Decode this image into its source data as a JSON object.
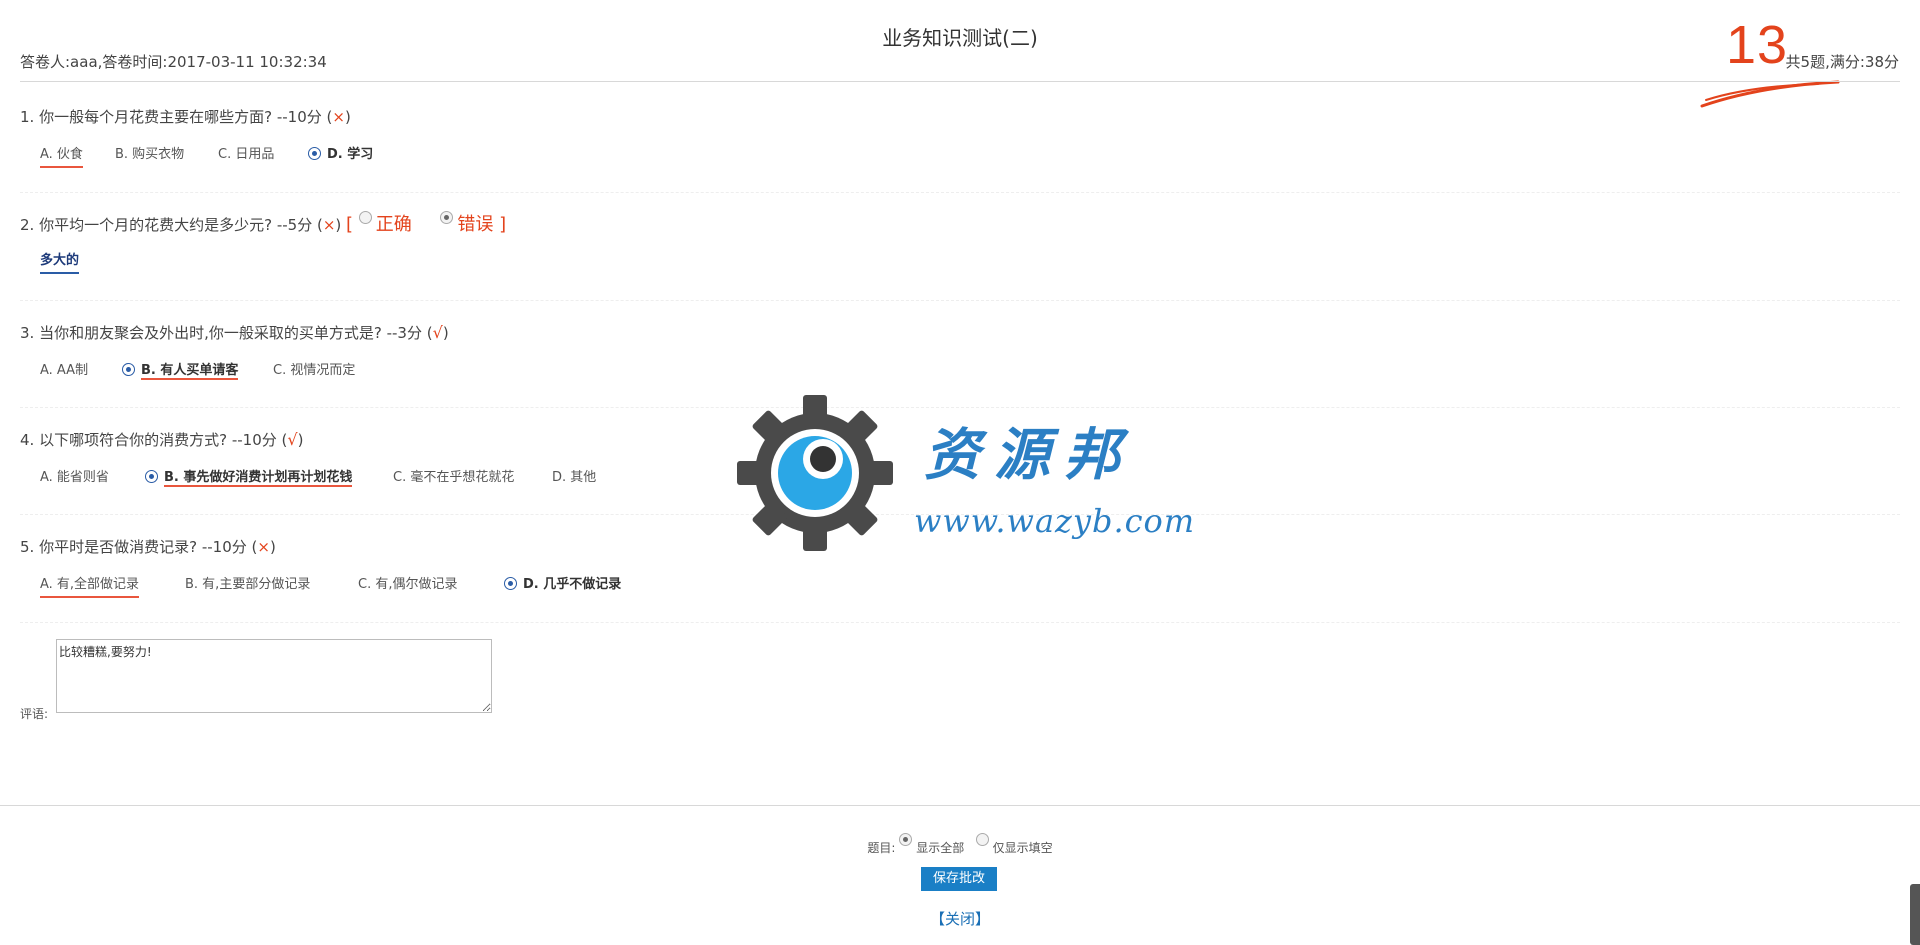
{
  "header": {
    "title": "业务知识测试(二)",
    "meta": "答卷人:aaa,答卷时间:2017-03-11 10:32:34",
    "score": "13",
    "summary": "共5题,满分:38分"
  },
  "questions": [
    {
      "num": "1.",
      "text": "你一般每个月花费主要在哪些方面?",
      "points": "--10分",
      "result": "×",
      "options": [
        {
          "label": "A. 伙食",
          "selected": false
        },
        {
          "label": "B. 购买衣物",
          "selected": false
        },
        {
          "label": "C. 日用品",
          "selected": false
        },
        {
          "label": "D. 学习",
          "selected": true
        }
      ]
    },
    {
      "num": "2.",
      "text": "你平均一个月的花费大约是多少元?",
      "points": "--5分",
      "result": "×",
      "judge_correct": "正确",
      "judge_wrong": "错误",
      "answer": "多大的"
    },
    {
      "num": "3.",
      "text": "当你和朋友聚会及外出时,你一般采取的买单方式是?",
      "points": "--3分",
      "result": "√",
      "options": [
        {
          "label": "A. AA制",
          "selected": false
        },
        {
          "label": "B. 有人买单请客",
          "selected": true
        },
        {
          "label": "C. 视情况而定",
          "selected": false
        }
      ]
    },
    {
      "num": "4.",
      "text": "以下哪项符合你的消费方式?",
      "points": "--10分",
      "result": "√",
      "options": [
        {
          "label": "A. 能省则省",
          "selected": false
        },
        {
          "label": "B. 事先做好消费计划再计划花钱",
          "selected": true
        },
        {
          "label": "C. 毫不在乎想花就花",
          "selected": false
        },
        {
          "label": "D. 其他",
          "selected": false
        }
      ]
    },
    {
      "num": "5.",
      "text": "你平时是否做消费记录?",
      "points": "--10分",
      "result": "×",
      "options": [
        {
          "label": "A. 有,全部做记录",
          "selected": false
        },
        {
          "label": "B. 有,主要部分做记录",
          "selected": false
        },
        {
          "label": "C. 有,偶尔做记录",
          "selected": false
        },
        {
          "label": "D. 几乎不做记录",
          "selected": true
        }
      ]
    }
  ],
  "comment": {
    "label": "评语:",
    "value": "比较糟糕,要努力!"
  },
  "footer": {
    "filter_label": "题目:",
    "filter_all": "显示全部",
    "filter_blank": "仅显示填空",
    "save_label": "保存批改",
    "close_label": "【关闭】"
  },
  "watermark": {
    "text": "资源邦",
    "url": "www.wazyb.com"
  },
  "colors": {
    "accent_red": "#e3431c",
    "accent_blue": "#1a7fc6",
    "radio_blue": "#2a5ca6"
  }
}
